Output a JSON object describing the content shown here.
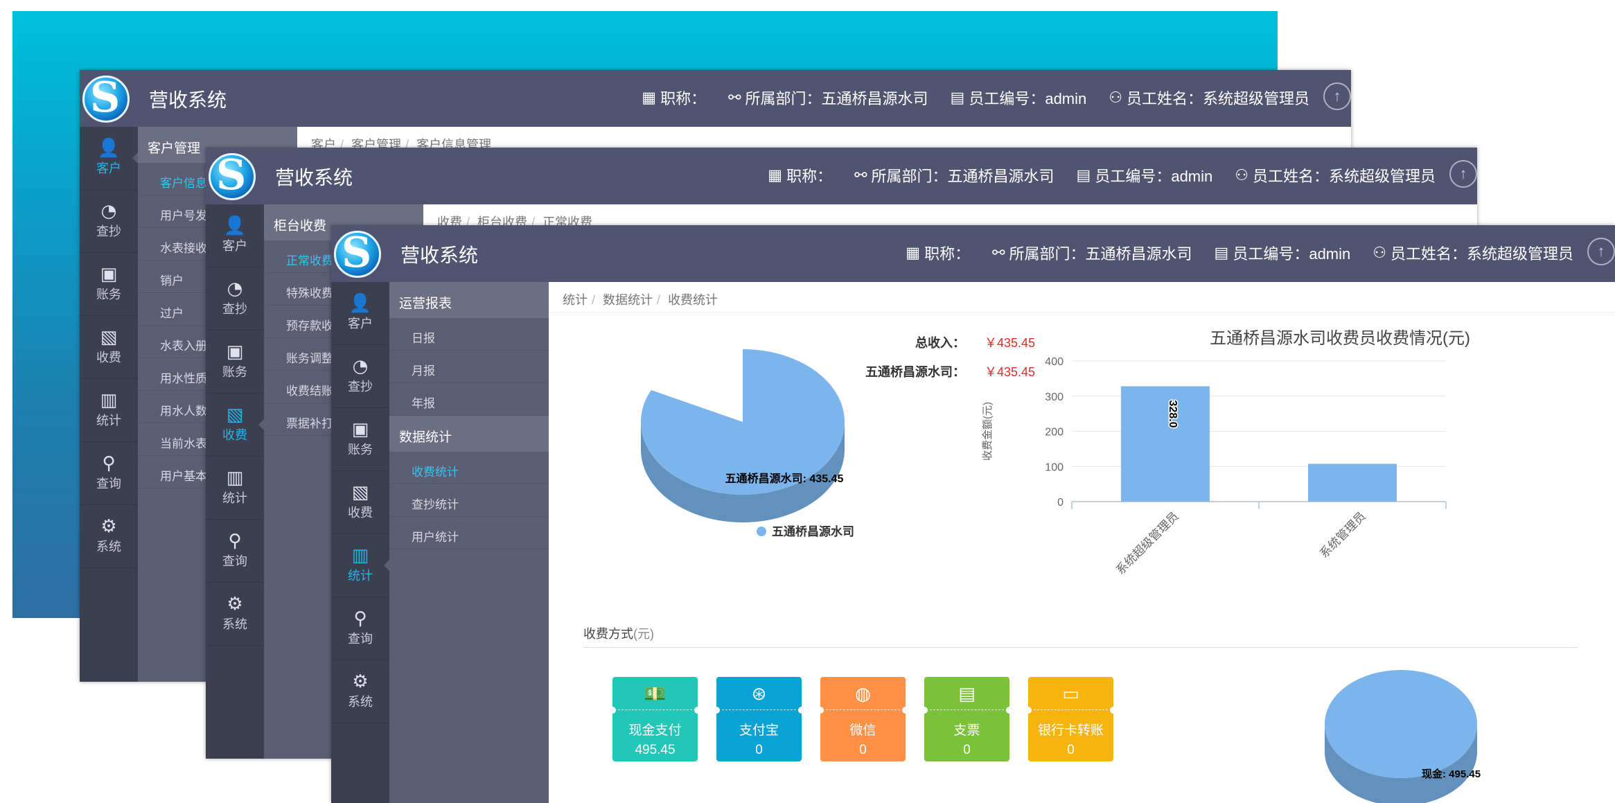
{
  "app": {
    "title": "营收系统"
  },
  "header": {
    "title_label": "职称：",
    "dept_label": "所属部门：五通桥昌源水司",
    "empno_label": "员工编号：admin",
    "name_label": "员工姓名：系统超级管理员"
  },
  "nav": {
    "customer": "客户",
    "reading": "查抄",
    "account": "账务",
    "charge": "收费",
    "stats": "统计",
    "query": "查询",
    "system": "系统"
  },
  "icons": {
    "customer": "user-icon",
    "reading": "gauge-icon",
    "account": "wallet-icon",
    "charge": "image-icon",
    "stats": "bar-chart-icon",
    "query": "search-icon",
    "system": "gear-icon",
    "upload": "upload-icon"
  },
  "w1": {
    "sub_title": "客户管理",
    "items": [
      "客户信息",
      "用户号发",
      "水表接收",
      "销户",
      "过户",
      "水表入册",
      "用水性质",
      "用水人数",
      "当前水表",
      "用户基本"
    ],
    "breadcrumb": [
      "客户",
      "客户管理",
      "客户信息管理"
    ]
  },
  "w2": {
    "sub_title": "柜台收费",
    "items": [
      "正常收费",
      "特殊收费",
      "预存款收",
      "账务调整",
      "收费结账",
      "票据补打"
    ],
    "breadcrumb": [
      "收费",
      "柜台收费",
      "正常收费"
    ]
  },
  "w3": {
    "groups": [
      {
        "title": "运营报表",
        "items": [
          "日报",
          "月报",
          "年报"
        ]
      },
      {
        "title": "数据统计",
        "items": [
          "收费统计",
          "查抄统计",
          "用户统计"
        ]
      }
    ],
    "breadcrumb": [
      "统计",
      "数据统计",
      "收费统计"
    ],
    "totals": [
      {
        "label": "总收入：",
        "value": "￥435.45"
      },
      {
        "label": "五通桥昌源水司：",
        "value": "￥435.45"
      }
    ],
    "payment_section": {
      "title": "收费方式",
      "unit": "(元)"
    },
    "payments": [
      {
        "label": "现金支付",
        "value": "495.45",
        "color": "#22c7b8",
        "icon": "cash-icon"
      },
      {
        "label": "支付宝",
        "value": "0",
        "color": "#0aa3d3",
        "icon": "alipay-icon"
      },
      {
        "label": "微信",
        "value": "0",
        "color": "#ff9146",
        "icon": "wechat-icon"
      },
      {
        "label": "支票",
        "value": "0",
        "color": "#79c23a",
        "icon": "check-icon"
      },
      {
        "label": "银行卡转账",
        "value": "0",
        "color": "#f8b40e",
        "icon": "bank-card-icon"
      }
    ]
  },
  "chart_data": [
    {
      "type": "pie",
      "title": "",
      "slices": [
        {
          "name": "五通桥昌源水司",
          "value": 435.45
        }
      ],
      "slice_label": "五通桥昌源水司: 435.45",
      "legend": [
        "五通桥昌源水司"
      ],
      "legend_position": "bottom",
      "color": "#7cb5ec"
    },
    {
      "type": "bar",
      "title": "五通桥昌源水司收费员收费情况(元)",
      "ylabel": "收费金额(元)",
      "categories": [
        "系统超级管理员",
        "系统管理员"
      ],
      "values": [
        328.0,
        107.45
      ],
      "data_labels": [
        "328.0"
      ],
      "ylim": [
        0,
        400
      ],
      "yticks": [
        "0",
        "100",
        "200",
        "300",
        "400"
      ],
      "color": "#7cb5ec",
      "grid": true
    },
    {
      "type": "pie",
      "title": "",
      "slices": [
        {
          "name": "现金",
          "value": 495.45
        }
      ],
      "slice_label": "现金: 495.45",
      "color": "#7cb5ec"
    }
  ]
}
